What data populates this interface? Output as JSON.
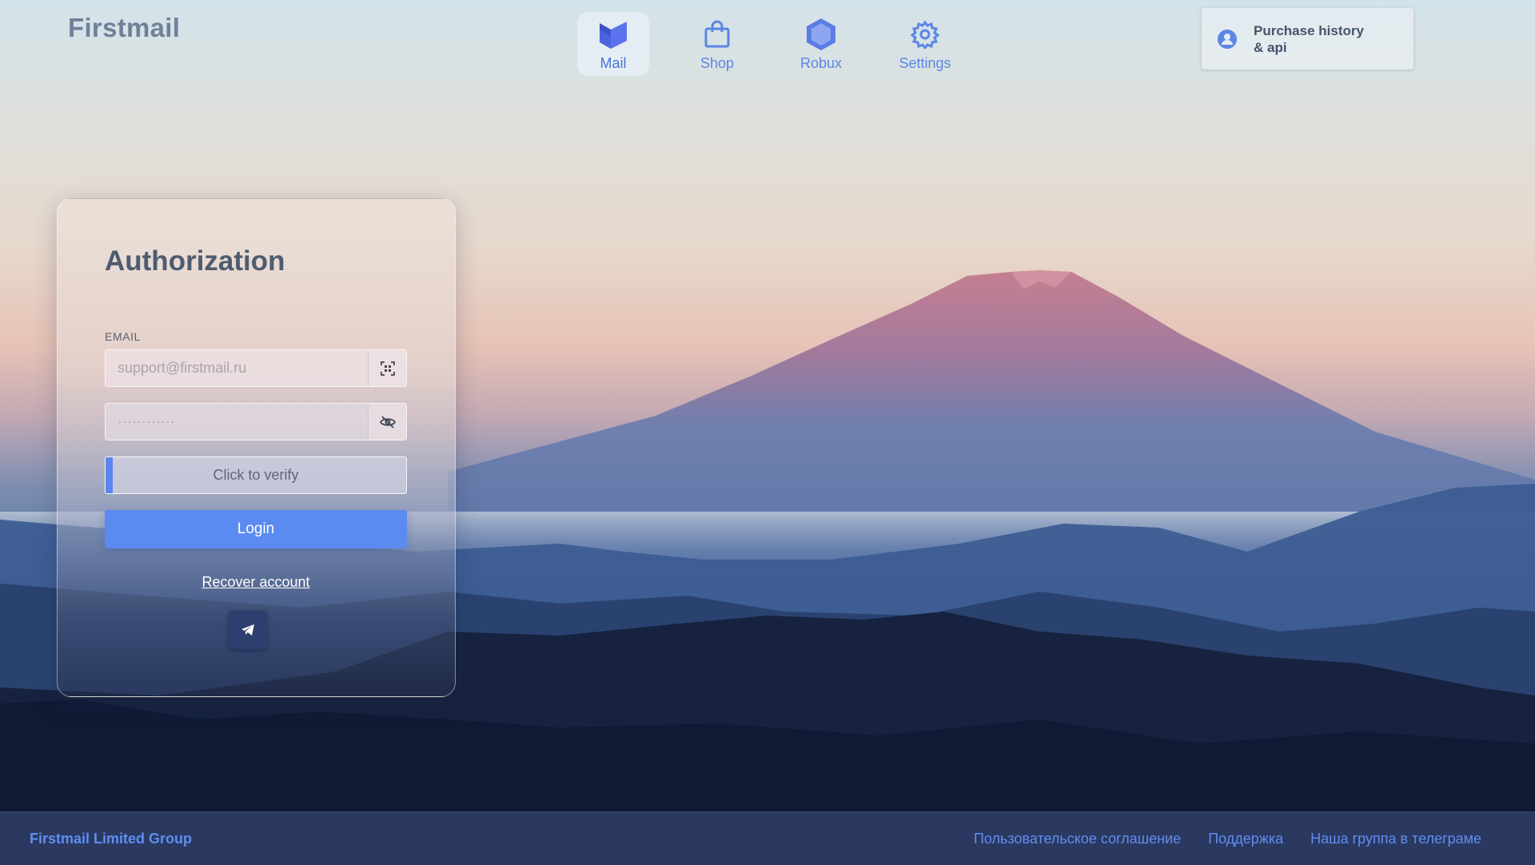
{
  "header": {
    "brand": "Firstmail",
    "nav": [
      {
        "label": "Mail",
        "icon": "mail-logo-icon",
        "active": true
      },
      {
        "label": "Shop",
        "icon": "shopping-bag-icon",
        "active": false
      },
      {
        "label": "Robux",
        "icon": "hexagon-icon",
        "active": false
      },
      {
        "label": "Settings",
        "icon": "gear-icon",
        "active": false
      }
    ],
    "purchase": {
      "label": "Purchase history & api",
      "icon": "user-circle-icon"
    }
  },
  "auth": {
    "title": "Authorization",
    "email_label": "EMAIL",
    "email_placeholder": "support@firstmail.ru",
    "email_addon_icon": "qr-scan-icon",
    "password_placeholder": "············",
    "password_addon_icon": "eye-off-icon",
    "verify_label": "Click to verify",
    "login_label": "Login",
    "recover_label": "Recover account",
    "telegram_icon": "telegram-icon"
  },
  "footer": {
    "brand": "Firstmail Limited Group",
    "links": [
      "Пользовательское соглашение",
      "Поддержка",
      "Наша группа в телеграме"
    ]
  },
  "colors": {
    "accent": "#5b8bf0",
    "nav_text": "#5b86e5",
    "footer_bg": "#2b3860",
    "telegram_button": "#2d3f6e"
  }
}
